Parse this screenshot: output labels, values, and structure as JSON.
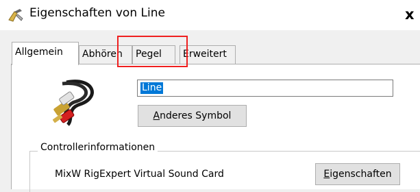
{
  "window": {
    "title": "Eigenschaften von Line",
    "close_glyph": "x"
  },
  "tabs": [
    {
      "label": "Allgemein",
      "active": true
    },
    {
      "label": "Abhören",
      "active": false
    },
    {
      "label": "Pegel",
      "active": false
    },
    {
      "label": "Erweitert",
      "active": false
    }
  ],
  "general": {
    "name_value": "Line",
    "change_icon_button": {
      "underlined": "A",
      "rest": "nderes Symbol"
    }
  },
  "controller": {
    "group_label": "Controllerinformationen",
    "device_name": "MixW RigExpert Virtual Sound Card",
    "properties_button": {
      "underlined": "E",
      "rest": "igenschaften"
    }
  },
  "colors": {
    "highlight": "#ef1f1f",
    "selection": "#0078d7"
  }
}
